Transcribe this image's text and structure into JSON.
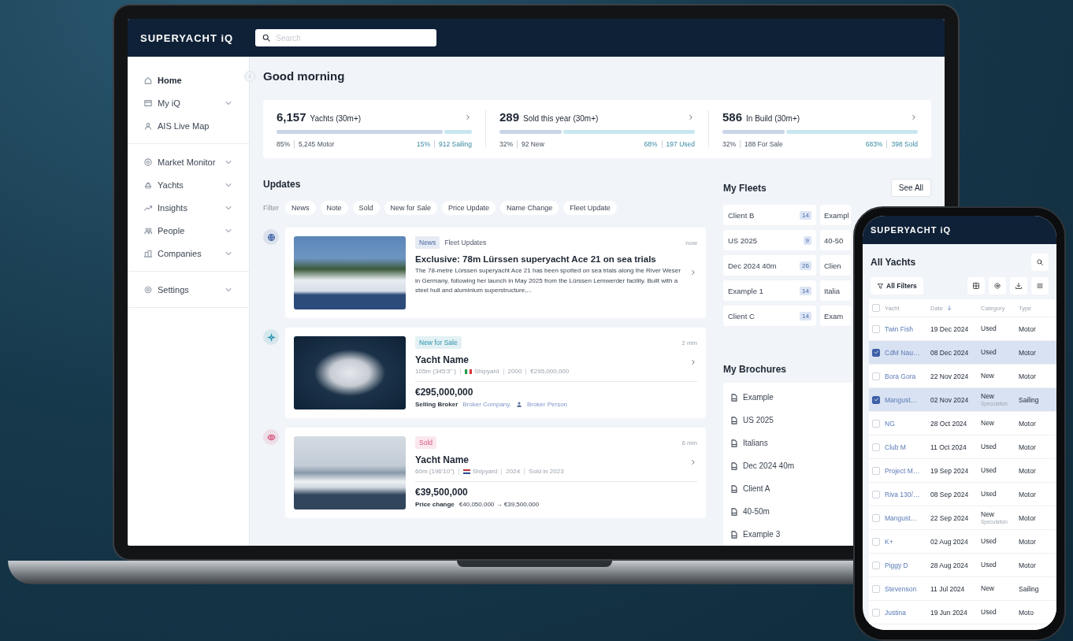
{
  "laptop": {
    "header": {
      "logo": "SUPERYACHT iQ",
      "search": {
        "placeholder": "Search"
      }
    },
    "sidebar": {
      "groups": [
        [
          {
            "label": "Home",
            "kind": "link",
            "selected": true
          },
          {
            "label": "My iQ",
            "kind": "menu",
            "selected": false
          },
          {
            "label": "AIS Live Map",
            "kind": "link",
            "selected": false
          }
        ],
        [
          {
            "label": "Market Monitor",
            "kind": "menu",
            "selected": false
          },
          {
            "label": "Yachts",
            "kind": "menu",
            "selected": false
          },
          {
            "label": "Insights",
            "kind": "menu",
            "selected": false
          },
          {
            "label": "People",
            "kind": "menu",
            "selected": false
          },
          {
            "label": "Companies",
            "kind": "menu",
            "selected": false
          }
        ],
        [
          {
            "label": "Settings",
            "kind": "menu",
            "selected": false
          }
        ]
      ]
    },
    "main": {
      "greeting": "Good morning",
      "stats": [
        {
          "value": "6,157",
          "label": "Yachts (30m+)",
          "level": 0.85,
          "left": {
            "percent": "85%",
            "count": "5,245 Motor"
          },
          "right": {
            "percent": "15%",
            "count": "912 Sailing"
          }
        },
        {
          "value": "289",
          "label": "Sold this year (30m+)",
          "level": 0.32,
          "left": {
            "percent": "32%",
            "count": "92 New"
          },
          "right": {
            "percent": "68%",
            "count": "197 Used"
          }
        },
        {
          "value": "586",
          "label": "In Build (30m+)",
          "level": 0.32,
          "left": {
            "percent": "32%",
            "count": "188 For Sale"
          },
          "right": {
            "percent": "683%",
            "count": "398 Sold"
          }
        }
      ],
      "updates": {
        "title": "Updates",
        "filter_label": "Filter",
        "filters": [
          "News",
          "Note",
          "Sold",
          "New for Sale",
          "Price Update",
          "Name Change",
          "Fleet Update"
        ],
        "feed": [
          {
            "kind": "news",
            "color": "#4a6aa8",
            "tag": "News",
            "secondary": "Fleet Updates",
            "time": "now",
            "title": "Exclusive: 78m Lürssen superyacht Ace 21 on sea trials",
            "body": "The 78-metre Lürssen superyacht Ace 21 has been spotted on sea trials along the River Weser in Germany, following her launch in May 2025 from the Lürssen Lemwerder facility. Built with a steel hull and aluminium superstructure,..."
          },
          {
            "kind": "listing",
            "color": "#2a93ad",
            "tag": "New for Sale",
            "time": "2 min",
            "title": "Yacht Name",
            "meta": [
              {
                "kind": "text",
                "text": "105m (345'3\" )"
              },
              {
                "kind": "shipyard",
                "text": "Shipyard"
              },
              {
                "kind": "text",
                "text": "2000"
              },
              {
                "kind": "text",
                "text": "€295,000,000"
              }
            ],
            "price": "€295,000,000",
            "details": [
              {
                "kind": "brokers",
                "label": "Selling Broker",
                "company": "Broker Company,",
                "person": "Broker Person"
              }
            ]
          },
          {
            "kind": "listing",
            "color": "#d9557f",
            "tag": "Sold",
            "time": "6 min",
            "title": "Yacht Name",
            "meta": [
              {
                "kind": "text",
                "text": "60m (196'10\")"
              },
              {
                "kind": "shipyard",
                "text": "Shipyard"
              },
              {
                "kind": "text",
                "text": "2024"
              },
              {
                "kind": "text",
                "text": "Sold in 2023"
              }
            ],
            "price": "€39,500,000",
            "details": [
              {
                "kind": "text",
                "label": "Price change",
                "text": "€40,050,000 → €39,500,000"
              }
            ]
          }
        ]
      },
      "fleets": {
        "title": "My Fleets",
        "button": "See All",
        "items": [
          {
            "name": "Client B",
            "count": "14"
          },
          {
            "name": "Exampl"
          },
          {
            "name": "US 2025",
            "count": "9"
          },
          {
            "name": "40-50"
          },
          {
            "name": "Dec 2024 40m",
            "count": "26"
          },
          {
            "name": "Clien"
          },
          {
            "name": "Example 1",
            "count": "14"
          },
          {
            "name": "Italia"
          },
          {
            "name": "Client C",
            "count": "14"
          },
          {
            "name": "Exam"
          }
        ]
      },
      "brochures": {
        "title": "My Brochures",
        "items": [
          "Example",
          "US 2025",
          "Italians",
          "Dec 2024 40m",
          "Client A",
          "40-50m",
          "Example 3"
        ]
      }
    }
  },
  "phone": {
    "logo": "SUPERYACHT iQ",
    "title": "All Yachts",
    "filters_button": "All Filters",
    "all_checked": false,
    "columns": [
      {
        "label": "Yacht",
        "sorted": false
      },
      {
        "label": "Date",
        "sorted": true
      },
      {
        "label": "Category",
        "sorted": false
      },
      {
        "label": "Type",
        "sorted": false
      }
    ],
    "rows": [
      {
        "name": "Twin Fish",
        "date": "19 Dec 2024",
        "category": "Used",
        "type": "Motor",
        "checked": false
      },
      {
        "name": "CdM Nau…",
        "date": "08 Dec 2024",
        "category": "Used",
        "type": "Motor",
        "checked": true
      },
      {
        "name": "Bora Gora",
        "date": "22 Nov 2024",
        "category": "New",
        "type": "Motor",
        "checked": false
      },
      {
        "name": "Mangust…",
        "date": "02 Nov 2024",
        "category": "New",
        "subcategory": "Speculation",
        "type": "Sailing",
        "checked": true
      },
      {
        "name": "NG",
        "date": "28 Oct 2024",
        "category": "New",
        "type": "Motor",
        "checked": false
      },
      {
        "name": "Club M",
        "date": "11 Oct 2024",
        "category": "Used",
        "type": "Motor",
        "checked": false
      },
      {
        "name": "Project M…",
        "date": "19 Sep 2024",
        "category": "Used",
        "type": "Motor",
        "checked": false
      },
      {
        "name": "Riva 130/…",
        "date": "08 Sep 2024",
        "category": "Used",
        "type": "Motor",
        "checked": false
      },
      {
        "name": "Mangust…",
        "date": "22 Sep 2024",
        "category": "New",
        "subcategory": "Speculation",
        "type": "Motor",
        "checked": false
      },
      {
        "name": "K+",
        "date": "02 Aug 2024",
        "category": "Used",
        "type": "Motor",
        "checked": false
      },
      {
        "name": "Piggy D",
        "date": "28 Aug 2024",
        "category": "Used",
        "type": "Motor",
        "checked": false
      },
      {
        "name": "Stevenson",
        "date": "11 Jul 2024",
        "category": "New",
        "type": "Sailing",
        "checked": false
      },
      {
        "name": "Justina",
        "date": "19 Jun 2024",
        "category": "Used",
        "type": "Moto",
        "checked": false
      }
    ]
  }
}
